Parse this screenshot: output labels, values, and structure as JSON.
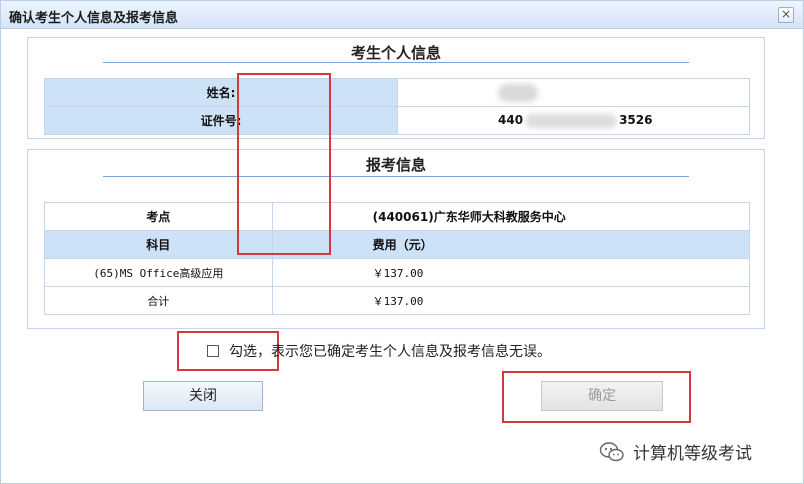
{
  "dialog": {
    "title": "确认考生个人信息及报考信息",
    "close_glyph": "×"
  },
  "personal": {
    "section_title": "考生个人信息",
    "name_label": "姓名:",
    "id_label": "证件号:",
    "id_prefix": "440",
    "id_suffix": "3526"
  },
  "exam": {
    "section_title": "报考信息",
    "center_label": "考点",
    "center_value": "(440061)广东华师大科教服务中心",
    "subject_header": "科目",
    "fee_header": "费用（元）",
    "rows": [
      {
        "subject": "(65)MS Office高级应用",
        "fee": "￥137.00"
      },
      {
        "subject": "合计",
        "fee": "￥137.00"
      }
    ]
  },
  "confirm": {
    "checkbox_glyph": "",
    "text_check": "勾选，",
    "text_rest": "表示您已确定考生个人信息及报考信息无误。"
  },
  "buttons": {
    "close_label": "关闭",
    "ok_label": "确定"
  },
  "watermark": {
    "text": "计算机等级考试",
    "icon": "wechat-icon"
  },
  "colors": {
    "header_cell_bg": "#cde1f7",
    "highlight_box": "#d43a3a",
    "panel_border": "#c6d6ea"
  }
}
